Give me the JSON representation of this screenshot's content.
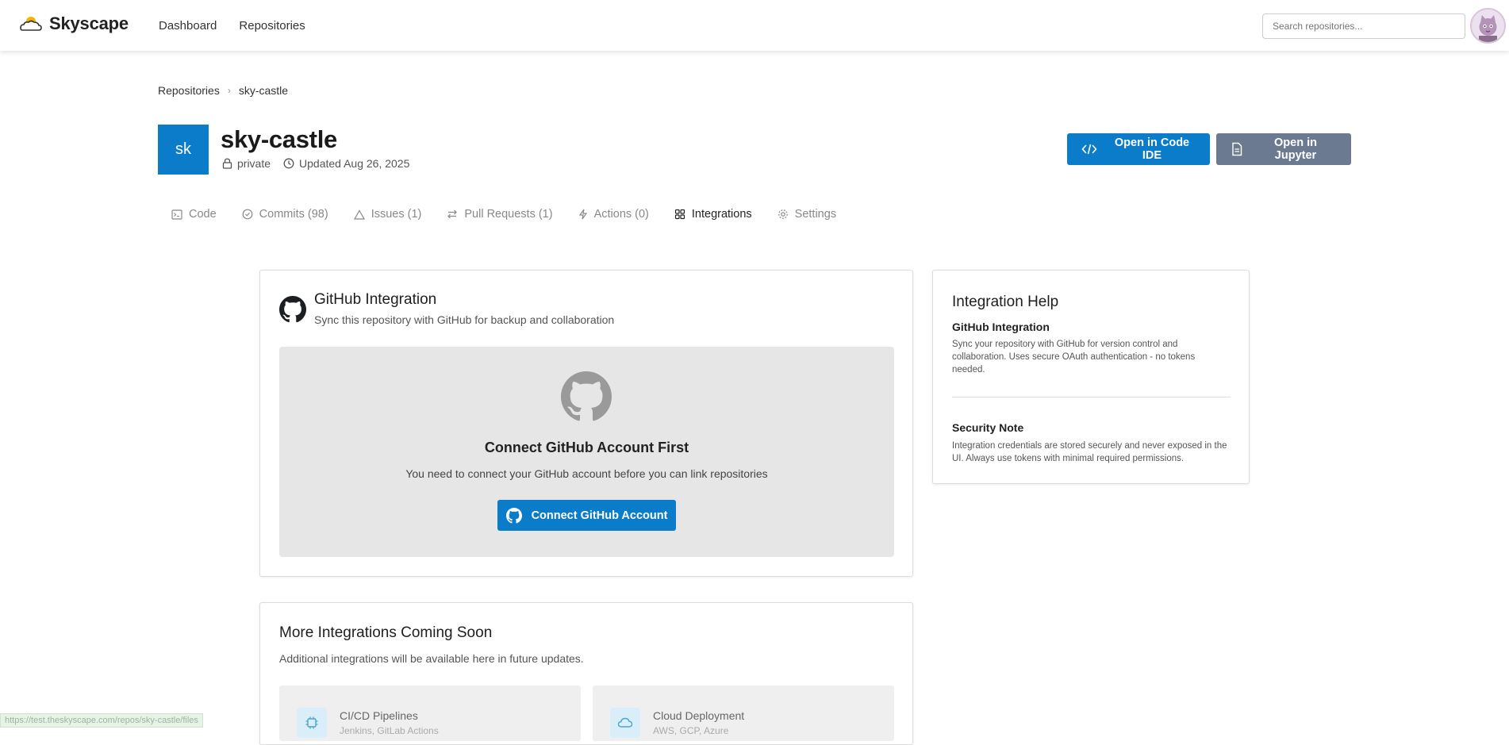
{
  "app": {
    "name": "Skyscape"
  },
  "nav": {
    "items": [
      "Dashboard",
      "Repositories"
    ]
  },
  "search": {
    "placeholder": "Search repositories..."
  },
  "breadcrumb": {
    "root": "Repositories",
    "current": "sky-castle"
  },
  "repo": {
    "initials": "sk",
    "name": "sky-castle",
    "visibility": "private",
    "updated": "Updated Aug 26, 2025"
  },
  "actions": {
    "open_ide": "Open in Code IDE",
    "open_jupyter": "Open in Jupyter"
  },
  "tabs": [
    {
      "label": "Code",
      "icon": "terminal-icon"
    },
    {
      "label": "Commits (98)",
      "icon": "check-circle-icon"
    },
    {
      "label": "Issues (1)",
      "icon": "warning-triangle-icon"
    },
    {
      "label": "Pull Requests (1)",
      "icon": "arrows-swap-icon"
    },
    {
      "label": "Actions (0)",
      "icon": "lightning-icon"
    },
    {
      "label": "Integrations",
      "icon": "grid-icon"
    },
    {
      "label": "Settings",
      "icon": "gear-icon"
    }
  ],
  "active_tab": "Integrations",
  "github_card": {
    "title": "GitHub Integration",
    "subtitle": "Sync this repository with GitHub for backup and collaboration",
    "connect_title": "Connect GitHub Account First",
    "connect_desc": "You need to connect your GitHub account before you can link repositories",
    "connect_button": "Connect GitHub Account"
  },
  "help": {
    "title": "Integration Help",
    "sections": [
      {
        "heading": "GitHub Integration",
        "text": "Sync your repository with GitHub for version control and collaboration. Uses secure OAuth authentication - no tokens needed."
      },
      {
        "heading": "Security Note",
        "text": "Integration credentials are stored securely and never exposed in the UI. Always use tokens with minimal required permissions."
      }
    ]
  },
  "more": {
    "title": "More Integrations Coming Soon",
    "subtitle": "Additional integrations will be available here in future updates.",
    "items": [
      {
        "name": "CI/CD Pipelines",
        "desc": "Jenkins, GitLab Actions",
        "icon": "chip-icon"
      },
      {
        "name": "Cloud Deployment",
        "desc": "AWS, GCP, Azure",
        "icon": "cloud-icon"
      }
    ]
  },
  "status_bar": {
    "url": "https://test.theskyscape.com/repos/sky-castle/files"
  },
  "colors": {
    "primary": "#0a7cc9",
    "secondary": "#6b7a90",
    "panel": "#e6e6e6"
  }
}
